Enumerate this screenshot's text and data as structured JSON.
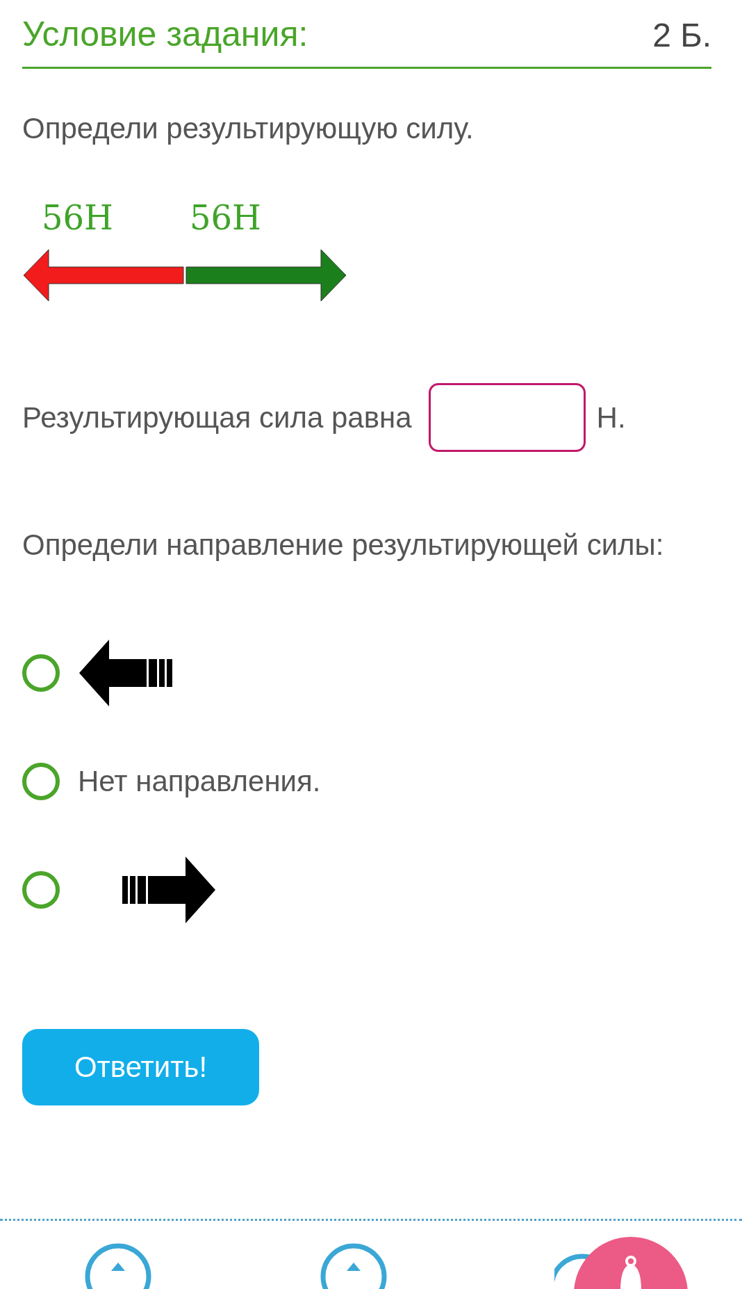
{
  "task": {
    "title": "Условие задания:",
    "points": "2 Б."
  },
  "question": "Определи результирующую силу.",
  "diagram": {
    "forces": [
      {
        "label": "56Н",
        "kind": "left",
        "color": "#f21c1c"
      },
      {
        "label": "56Н",
        "kind": "right",
        "color": "#1b7f1b"
      }
    ]
  },
  "answer": {
    "label": "Результирующая сила равна",
    "unit": "Н."
  },
  "direction_question": "Определи направление результирующей силы:",
  "options": [
    {
      "kind": "arrow-left",
      "selected": false
    },
    {
      "kind": "text",
      "text": "Нет направления.",
      "selected": false
    },
    {
      "kind": "arrow-right",
      "selected": false
    }
  ],
  "submit_button": "Ответить!"
}
